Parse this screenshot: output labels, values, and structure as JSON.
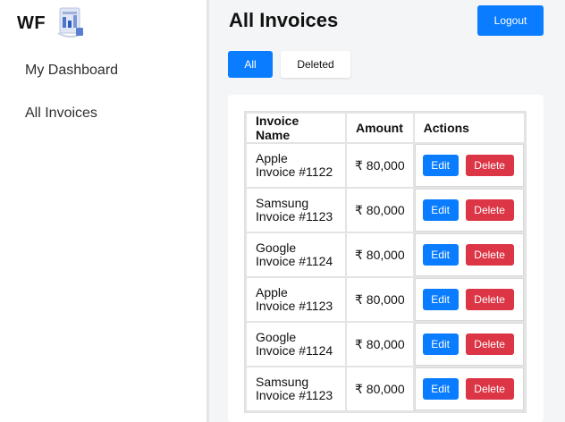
{
  "sidebar": {
    "brand": "WF",
    "items": [
      {
        "label": "My Dashboard"
      },
      {
        "label": "All Invoices"
      }
    ]
  },
  "header": {
    "title": "All Invoices",
    "logout_label": "Logout"
  },
  "tabs": [
    {
      "label": "All",
      "active": true
    },
    {
      "label": "Deleted",
      "active": false
    }
  ],
  "table": {
    "columns": [
      "Invoice Name",
      "Amount",
      "Actions"
    ],
    "edit_label": "Edit",
    "delete_label": "Delete",
    "rows": [
      {
        "name_line1": "Apple",
        "name_line2": "Invoice #1122",
        "amount": "₹ 80,000"
      },
      {
        "name_line1": "Samsung",
        "name_line2": "Invoice #1123",
        "amount": "₹ 80,000"
      },
      {
        "name_line1": "Google",
        "name_line2": "Invoice #1124",
        "amount": "₹ 80,000"
      },
      {
        "name_line1": "Apple",
        "name_line2": "Invoice #1123",
        "amount": "₹ 80,000"
      },
      {
        "name_line1": "Google",
        "name_line2": "Invoice #1124",
        "amount": "₹ 80,000"
      },
      {
        "name_line1": "Samsung",
        "name_line2": "Invoice #1123",
        "amount": "₹ 80,000"
      }
    ]
  },
  "colors": {
    "primary": "#0a7cff",
    "danger": "#dc3545",
    "page_bg": "#f4f5f7"
  },
  "icons": {
    "logo": "app-logo-icon"
  }
}
